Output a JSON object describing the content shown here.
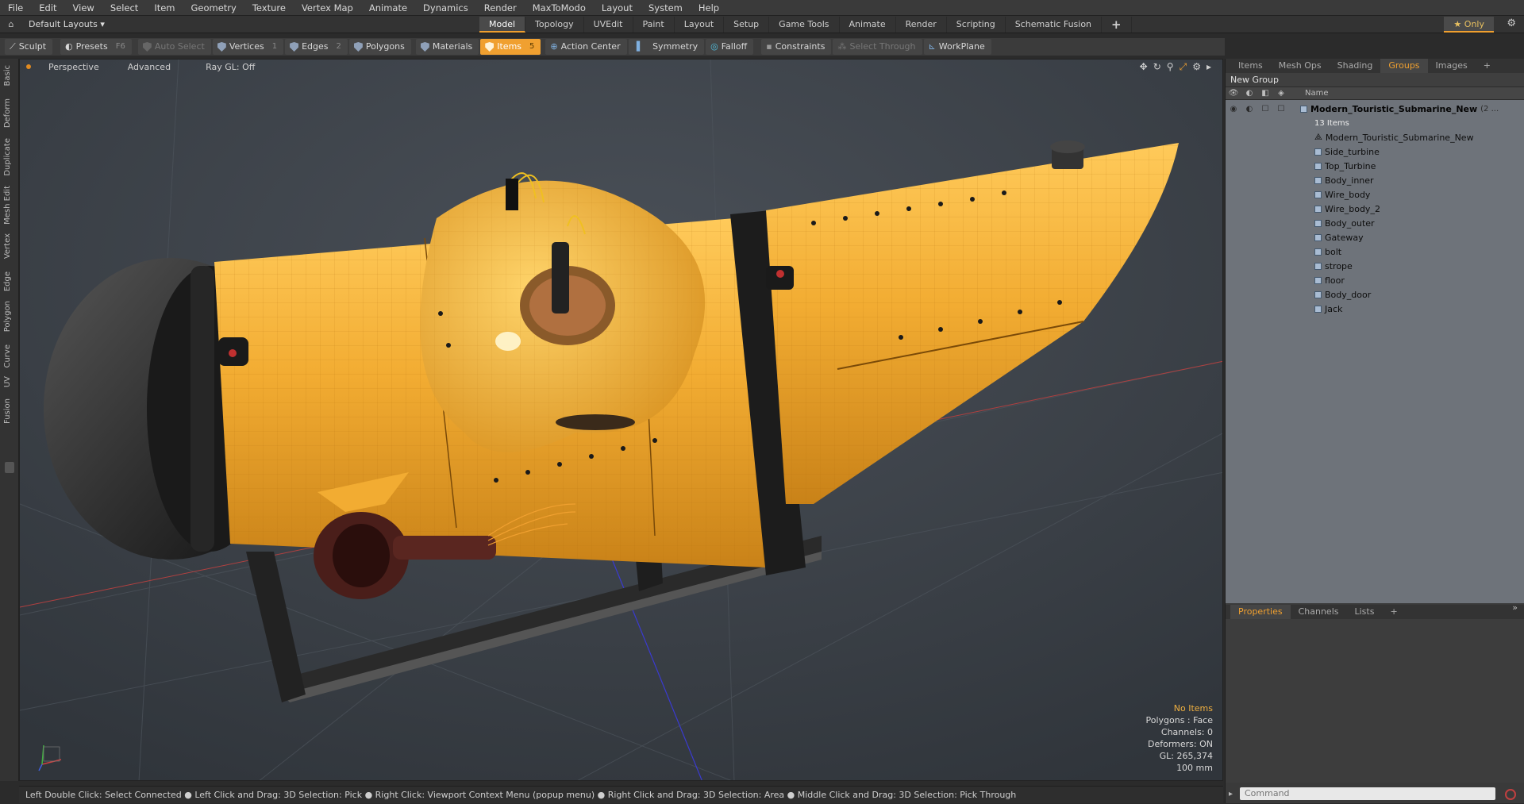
{
  "menu": [
    "File",
    "Edit",
    "View",
    "Select",
    "Item",
    "Geometry",
    "Texture",
    "Vertex Map",
    "Animate",
    "Dynamics",
    "Render",
    "MaxToModo",
    "Layout",
    "System",
    "Help"
  ],
  "layouts_label": "Default Layouts",
  "mode_tabs": [
    "Model",
    "Topology",
    "UVEdit",
    "Paint",
    "Layout",
    "Setup",
    "Game Tools",
    "Animate",
    "Render",
    "Scripting",
    "Schematic Fusion",
    "+"
  ],
  "active_mode": "Model",
  "only_label": "Only",
  "toolbar": {
    "sculpt": "Sculpt",
    "presets": "Presets",
    "presets_key": "F6",
    "auto_select": "Auto Select",
    "vertices": "Vertices",
    "vertices_key": "1",
    "edges": "Edges",
    "edges_key": "2",
    "polygons": "Polygons",
    "materials": "Materials",
    "items": "Items",
    "items_key": "5",
    "action_center": "Action Center",
    "symmetry": "Symmetry",
    "falloff": "Falloff",
    "constraints": "Constraints",
    "select_through": "Select Through",
    "workplane": "WorkPlane"
  },
  "viewport": {
    "view": "Perspective",
    "mode": "Advanced",
    "raygl": "Ray GL: Off",
    "info": {
      "items": "No Items",
      "polygons": "Polygons : Face",
      "channels": "Channels: 0",
      "deformers": "Deformers: ON",
      "gl": "GL: 265,374",
      "scale": "100 mm"
    }
  },
  "left_tabs": [
    "Basic",
    "Deform",
    "Duplicate",
    "Mesh Edit",
    "Vertex",
    "Edge",
    "Polygon",
    "Curve",
    "UV",
    "Fusion"
  ],
  "status_text": "Left Double Click: Select Connected ● Left Click and Drag: 3D Selection: Pick ● Right Click: Viewport Context Menu (popup menu) ● Right Click and Drag: 3D Selection: Area ● Middle Click and Drag: 3D Selection: Pick Through",
  "panel": {
    "tabs": [
      "Items",
      "Mesh Ops",
      "Shading",
      "Groups",
      "Images",
      "+"
    ],
    "active_tab": "Groups",
    "new_group": "New Group",
    "name_header": "Name",
    "root": "Modern_Touristic_Submarine_New",
    "root_suffix": "(2 ...",
    "root_sub": "13 Items",
    "items": [
      "Modern_Touristic_Submarine_New",
      "Side_turbine",
      "Top_Turbine",
      "Body_inner",
      "Wire_body",
      "Wire_body_2",
      "Body_outer",
      "Gateway",
      "bolt",
      "strope",
      "floor",
      "Body_door",
      "Jack"
    ],
    "bottom_tabs": [
      "Properties",
      "Channels",
      "Lists",
      "+"
    ],
    "command_placeholder": "Command"
  },
  "colors": {
    "accent": "#f0a030",
    "hull": "#f2ac32",
    "viewport_bg": "#3a3f45",
    "tree_bg": "#6e737a"
  }
}
